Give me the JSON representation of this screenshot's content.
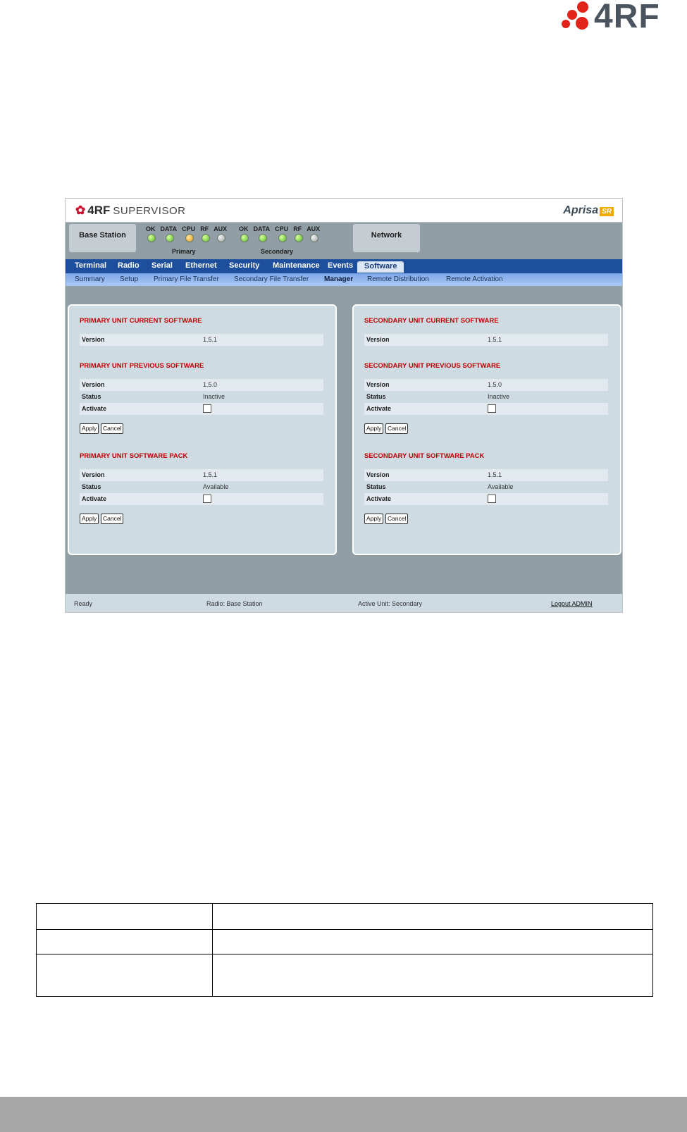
{
  "logo": {
    "text": "4RF",
    "accent": "#e2231a"
  },
  "app": {
    "brand": {
      "name": "4RF",
      "product": "SUPERVISOR"
    },
    "product_logo": {
      "name": "Aprisa",
      "badge": "SR"
    },
    "station_box": "Base Station",
    "network_box": "Network",
    "primary": {
      "title": "Primary",
      "leds": [
        {
          "label": "OK",
          "color": "green"
        },
        {
          "label": "DATA",
          "color": "green"
        },
        {
          "label": "CPU",
          "color": "orange"
        },
        {
          "label": "RF",
          "color": "green"
        },
        {
          "label": "AUX",
          "color": "grey"
        }
      ]
    },
    "secondary": {
      "title": "Secondary",
      "leds": [
        {
          "label": "OK",
          "color": "green"
        },
        {
          "label": "DATA",
          "color": "green"
        },
        {
          "label": "CPU",
          "color": "green"
        },
        {
          "label": "RF",
          "color": "green"
        },
        {
          "label": "AUX",
          "color": "grey"
        }
      ]
    },
    "nav": [
      "Terminal",
      "Radio",
      "Serial",
      "Ethernet",
      "Security",
      "Maintenance",
      "Events",
      "Software"
    ],
    "nav_active": "Software",
    "subnav": [
      "Summary",
      "Setup",
      "Primary File Transfer",
      "Secondary File Transfer",
      "Manager",
      "Remote Distribution",
      "Remote Activation"
    ],
    "subnav_active": "Manager",
    "panels": {
      "primary": {
        "current": {
          "title": "PRIMARY UNIT CURRENT SOFTWARE",
          "version_label": "Version",
          "version": "1.5.1"
        },
        "previous": {
          "title": "PRIMARY UNIT PREVIOUS SOFTWARE",
          "version_label": "Version",
          "version": "1.5.0",
          "status_label": "Status",
          "status": "Inactive",
          "activate_label": "Activate"
        },
        "pack": {
          "title": "PRIMARY UNIT SOFTWARE PACK",
          "version_label": "Version",
          "version": "1.5.1",
          "status_label": "Status",
          "status": "Available",
          "activate_label": "Activate"
        }
      },
      "secondary": {
        "current": {
          "title": "SECONDARY UNIT CURRENT SOFTWARE",
          "version_label": "Version",
          "version": "1.5.1"
        },
        "previous": {
          "title": "SECONDARY UNIT PREVIOUS SOFTWARE",
          "version_label": "Version",
          "version": "1.5.0",
          "status_label": "Status",
          "status": "Inactive",
          "activate_label": "Activate"
        },
        "pack": {
          "title": "SECONDARY UNIT SOFTWARE PACK",
          "version_label": "Version",
          "version": "1.5.1",
          "status_label": "Status",
          "status": "Available",
          "activate_label": "Activate"
        }
      }
    },
    "buttons": {
      "apply": "Apply",
      "cancel": "Cancel"
    },
    "status_bar": {
      "state": "Ready",
      "radio": "Radio: Base Station",
      "active_unit": "Active Unit: Secondary",
      "logout": "Logout ADMIN"
    }
  },
  "colors": {
    "nav_bg": "#1d4f9c",
    "section_title": "#c00000",
    "panel_bg": "#cfdbe3"
  }
}
